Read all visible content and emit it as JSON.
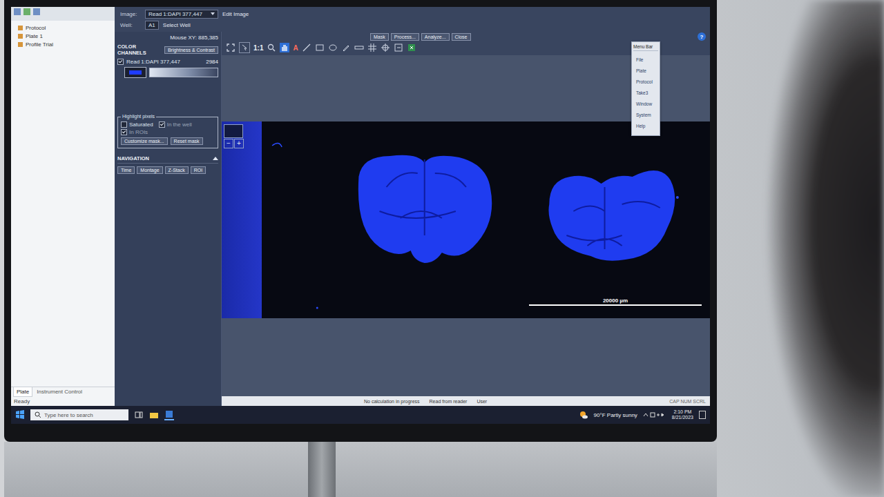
{
  "left_pane": {
    "tree": [
      {
        "label": "Protocol"
      },
      {
        "label": "Plate 1"
      },
      {
        "label": "Profile Trial"
      }
    ],
    "tabs": [
      {
        "label": "Plate",
        "selected": true
      },
      {
        "label": "Instrument Control",
        "selected": false
      }
    ],
    "status": "Ready"
  },
  "image_field": {
    "label": "Image:",
    "value": "Read 1:DAPI 377,447",
    "action": "Edit Image"
  },
  "well_field": {
    "label": "Well:",
    "value": "A1",
    "action": "Select Well"
  },
  "mouse_xy": "Mouse XY:  885,385",
  "color_channels": {
    "title": "COLOR CHANNELS",
    "button": "Brightness & Contrast",
    "channels": [
      {
        "name": "Read 1:DAPI 377,447",
        "checked": true,
        "max": "2984",
        "color": "#1f3cff"
      }
    ]
  },
  "highlight_pixels": {
    "title": "Highlight pixels",
    "options": [
      {
        "label": "Saturated",
        "checked": false,
        "disabled": false
      },
      {
        "label": "In the well",
        "checked": true,
        "disabled": true
      },
      {
        "label": "In ROIs",
        "checked": true,
        "disabled": true
      }
    ],
    "buttons": [
      "Customize mask...",
      "Reset mask"
    ]
  },
  "navigation": {
    "title": "NAVIGATION",
    "expanded": true,
    "buttons": [
      "Time",
      "Montage",
      "Z-Stack",
      "ROI"
    ]
  },
  "tools_text": {
    "ratio": "1:1",
    "text_tool": "A"
  },
  "toolbar_buttons": [
    "Mask",
    "Process...",
    "Analyze...",
    "Close"
  ],
  "help": "?",
  "viewer": {
    "zoom_controls": [
      "−",
      "+"
    ],
    "scale_bar": "20000 µm"
  },
  "menu_bar": {
    "title": "Menu Bar",
    "items": [
      "File",
      "Plate",
      "Protocol",
      "Take3",
      "Window",
      "System",
      "Help"
    ]
  },
  "status_bar": {
    "center": "No calculation in progress",
    "right": [
      "Read from reader",
      "User"
    ],
    "flags": "CAP NUM SCRL"
  },
  "taskbar": {
    "search_placeholder": "Type here to search",
    "weather": {
      "temp": "90°F",
      "text": "Partly sunny"
    },
    "time": "2:10 PM",
    "date": "8/21/2023"
  }
}
